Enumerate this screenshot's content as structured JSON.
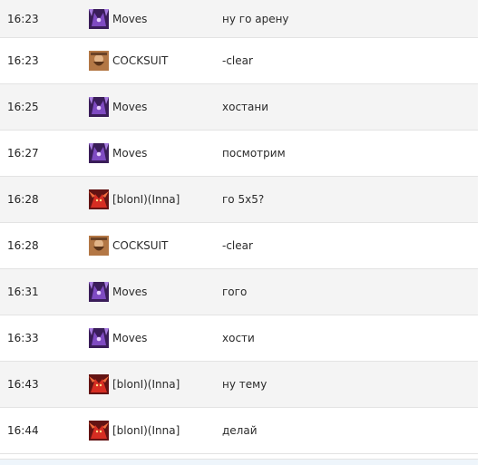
{
  "messages": [
    {
      "time": "16:23",
      "user": "Moves",
      "avatar": "night-elf-icon",
      "text": "ну го арену"
    },
    {
      "time": "16:23",
      "user": "COCKSUIT",
      "avatar": "dwarf-icon",
      "text": "-clear"
    },
    {
      "time": "16:25",
      "user": "Moves",
      "avatar": "night-elf-icon",
      "text": "хостани"
    },
    {
      "time": "16:27",
      "user": "Moves",
      "avatar": "night-elf-icon",
      "text": "посмотрим"
    },
    {
      "time": "16:28",
      "user": "[blonI)(Inna]",
      "avatar": "demon-icon",
      "text": "го 5x5?"
    },
    {
      "time": "16:28",
      "user": "COCKSUIT",
      "avatar": "dwarf-icon",
      "text": "-clear"
    },
    {
      "time": "16:31",
      "user": "Moves",
      "avatar": "night-elf-icon",
      "text": "гого"
    },
    {
      "time": "16:33",
      "user": "Moves",
      "avatar": "night-elf-icon",
      "text": "хости"
    },
    {
      "time": "16:43",
      "user": "[blonI)(Inna]",
      "avatar": "demon-icon",
      "text": "ну тему"
    },
    {
      "time": "16:44",
      "user": "[blonI)(Inna]",
      "avatar": "demon-icon",
      "text": "делай"
    }
  ],
  "colors": {
    "row_alt": "#f4f4f4",
    "border": "#e3e3e3",
    "text": "#2b2b2b"
  }
}
